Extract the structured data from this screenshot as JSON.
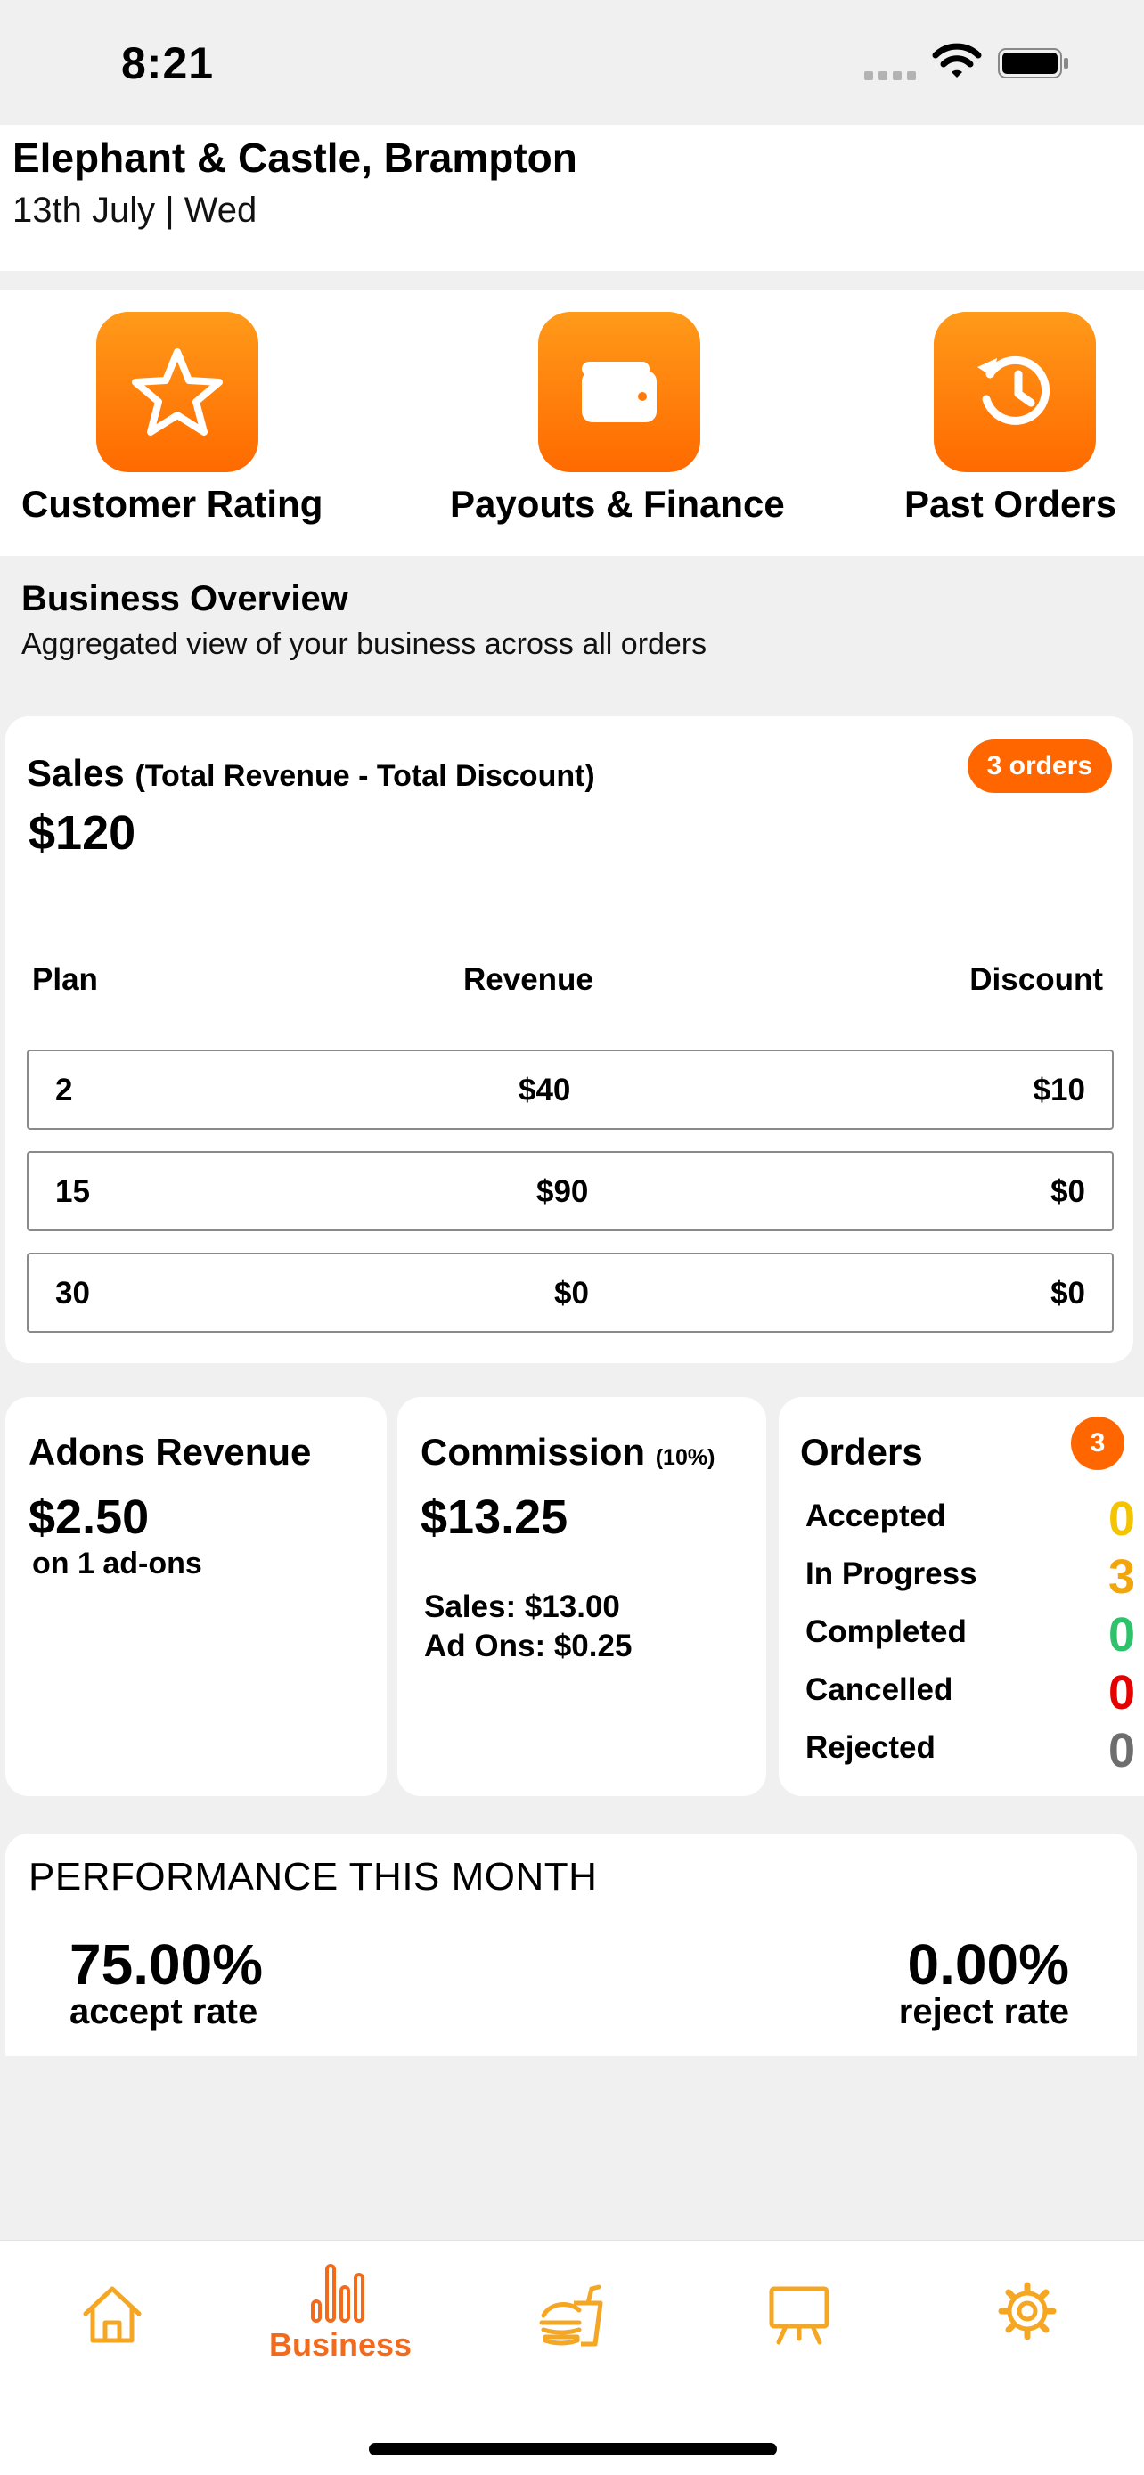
{
  "status_bar": {
    "time": "8:21"
  },
  "header": {
    "store_name": "Elephant & Castle, Brampton",
    "date": "13th July | Wed"
  },
  "quick_actions": [
    {
      "label": "Customer Rating",
      "icon": "star-icon"
    },
    {
      "label": "Payouts & Finance",
      "icon": "wallet-icon"
    },
    {
      "label": "Past Orders",
      "icon": "history-icon"
    }
  ],
  "overview": {
    "title": "Business Overview",
    "subtitle": "Aggregated view of your business across all orders"
  },
  "sales": {
    "title": "Sales",
    "formula": "(Total Revenue - Total Discount)",
    "orders_badge": "3 orders",
    "amount": "$120",
    "columns": [
      "Plan",
      "Revenue",
      "Discount"
    ],
    "rows": [
      {
        "plan": "2",
        "revenue": "$40",
        "discount": "$10"
      },
      {
        "plan": "15",
        "revenue": "$90",
        "discount": "$0"
      },
      {
        "plan": "30",
        "revenue": "$0",
        "discount": "$0"
      }
    ]
  },
  "adons": {
    "title": "Adons Revenue",
    "amount": "$2.50",
    "note": "on 1 ad-ons"
  },
  "commission": {
    "title": "Commission",
    "rate": "(10%)",
    "amount": "$13.25",
    "sales_line": "Sales: $13.00",
    "adons_line": "Ad Ons: $0.25"
  },
  "orders": {
    "title": "Orders",
    "count": "3",
    "rows": [
      {
        "label": "Accepted",
        "value": "0",
        "color": "#f5c400"
      },
      {
        "label": "In Progress",
        "value": "3",
        "color": "#f2a60c"
      },
      {
        "label": "Completed",
        "value": "0",
        "color": "#2ec26a"
      },
      {
        "label": "Cancelled",
        "value": "0",
        "color": "#e60000"
      },
      {
        "label": "Rejected",
        "value": "0",
        "color": "#6e6e6e"
      }
    ]
  },
  "performance": {
    "title": "PERFORMANCE THIS MONTH",
    "accept_value": "75.00%",
    "accept_label": "accept rate",
    "reject_value": "0.00%",
    "reject_label": "reject rate"
  },
  "tabbar": {
    "accent": "#f26a1b",
    "items": [
      {
        "icon": "home-icon",
        "label": ""
      },
      {
        "icon": "bar-chart-icon",
        "label": "Business"
      },
      {
        "icon": "food-icon",
        "label": ""
      },
      {
        "icon": "presentation-board-icon",
        "label": ""
      },
      {
        "icon": "gear-icon",
        "label": ""
      }
    ]
  }
}
